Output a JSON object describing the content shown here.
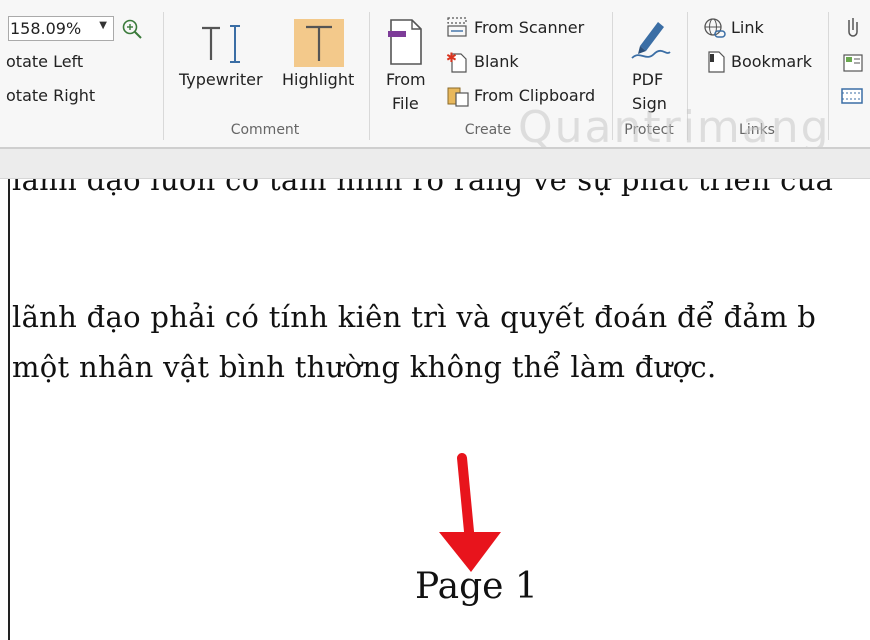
{
  "colors": {
    "highlight_bg": "#f3c98b",
    "arrow": "#e8141c",
    "accent_blue": "#3b6ea5",
    "accent_purple": "#7d3c98"
  },
  "ribbon": {
    "zoom_value": "158.09%",
    "rotate_left": "otate Left",
    "rotate_right": "otate Right",
    "typewriter": "Typewriter",
    "highlight": "Highlight",
    "comment_group": "Comment",
    "from_file_line1": "From",
    "from_file_line2": "File",
    "from_scanner": "From Scanner",
    "blank": "Blank",
    "from_clipboard": "From Clipboard",
    "create_group": "Create",
    "pdf_sign_line1": "PDF",
    "pdf_sign_line2": "Sign",
    "protect_group": "Protect",
    "link": "Link",
    "bookmark": "Bookmark",
    "links_group": "Links"
  },
  "document": {
    "line1": "lãnh đạo luôn có tầm nhìn rõ ràng về sự phát triển của",
    "line2": "lãnh đạo phải có tính kiên trì và quyết đoán để đảm b",
    "line3": "một nhân vật bình thường không thể làm được.",
    "page_label": "Page 1"
  },
  "watermark": "Quantrimang"
}
